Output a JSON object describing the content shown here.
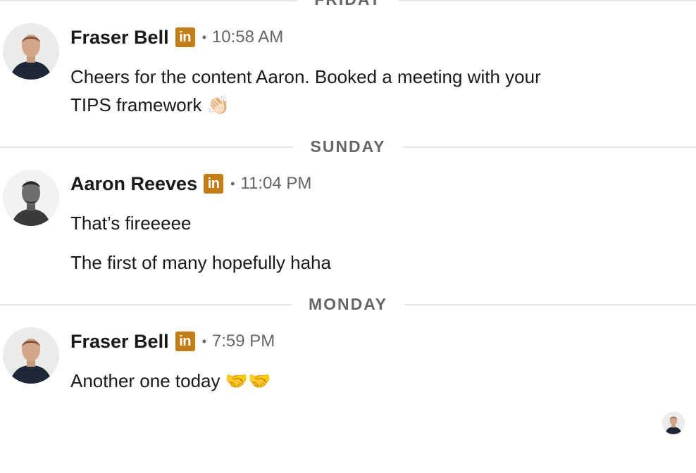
{
  "dividers": {
    "friday": "FRIDAY",
    "sunday": "SUNDAY",
    "monday": "MONDAY"
  },
  "messages": [
    {
      "sender": "Fraser Bell",
      "badge": "in",
      "separator": "•",
      "time": "10:58 AM",
      "lines": [
        "Cheers for the content Aaron. Booked a meeting with your",
        "TIPS framework 👏🏻"
      ]
    },
    {
      "sender": "Aaron Reeves",
      "badge": "in",
      "separator": "•",
      "time": "11:04 PM",
      "lines": [
        "That’s fireeeee",
        "The first of many hopefully haha"
      ]
    },
    {
      "sender": "Fraser Bell",
      "badge": "in",
      "separator": "•",
      "time": "7:59 PM",
      "lines": [
        "Another one today 🤝🤝"
      ]
    }
  ],
  "icons": {
    "badge": "linkedin-icon",
    "avatar_fraser": "avatar-fraser-bell",
    "avatar_aaron": "avatar-aaron-reeves",
    "read_receipt": "read-receipt-avatar"
  },
  "colors": {
    "badge": "#c37d16",
    "divider_text": "#666666",
    "time_text": "#666666",
    "body_text": "#191919",
    "divider_line": "#e6e6e6"
  }
}
